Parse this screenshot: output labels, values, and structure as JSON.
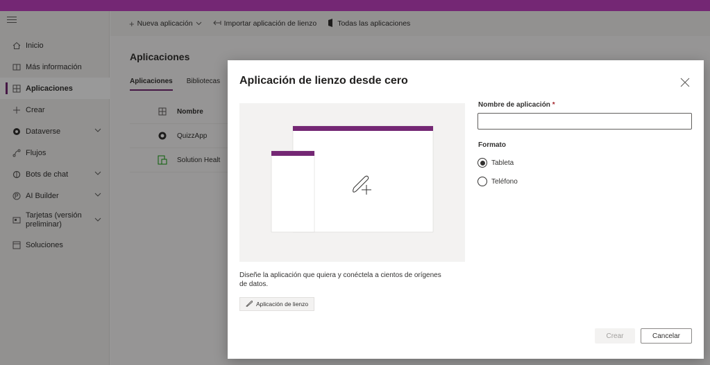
{
  "app": {
    "accent": "#742774"
  },
  "sidebar": {
    "items": [
      {
        "label": "Inicio",
        "icon": "home-icon"
      },
      {
        "label": "Más información",
        "icon": "book-icon"
      },
      {
        "label": "Aplicaciones",
        "icon": "apps-icon",
        "active": true
      },
      {
        "label": "Crear",
        "icon": "plus-icon"
      },
      {
        "label": "Dataverse",
        "icon": "dataverse-icon",
        "expandable": true
      },
      {
        "label": "Flujos",
        "icon": "flow-icon"
      },
      {
        "label": "Bots de chat",
        "icon": "bot-icon",
        "expandable": true
      },
      {
        "label": "AI Builder",
        "icon": "ai-builder-icon",
        "expandable": true
      },
      {
        "label": "Tarjetas (versión preliminar)",
        "icon": "cards-icon",
        "expandable": true
      },
      {
        "label": "Soluciones",
        "icon": "solutions-icon"
      }
    ]
  },
  "commandbar": {
    "new_app": "Nueva aplicación",
    "import_app": "Importar aplicación de lienzo",
    "all_apps": "Todas las aplicaciones"
  },
  "page": {
    "title": "Aplicaciones",
    "tabs": [
      "Aplicaciones",
      "Bibliotecas"
    ],
    "table_header": "Nombre",
    "rows": [
      "QuizzApp",
      "Solution Healt"
    ]
  },
  "dialog": {
    "title": "Aplicación de lienzo desde cero",
    "description": "Diseñe la aplicación que quiera y conéctela a cientos de orígenes de datos.",
    "canvas_button": "Aplicación de lienzo",
    "name_label": "Nombre de aplicación",
    "required_mark": "*",
    "name_value": "",
    "format_label": "Formato",
    "format_options": [
      {
        "label": "Tableta",
        "selected": true
      },
      {
        "label": "Teléfono",
        "selected": false
      }
    ],
    "create_button": "Crear",
    "cancel_button": "Cancelar"
  }
}
